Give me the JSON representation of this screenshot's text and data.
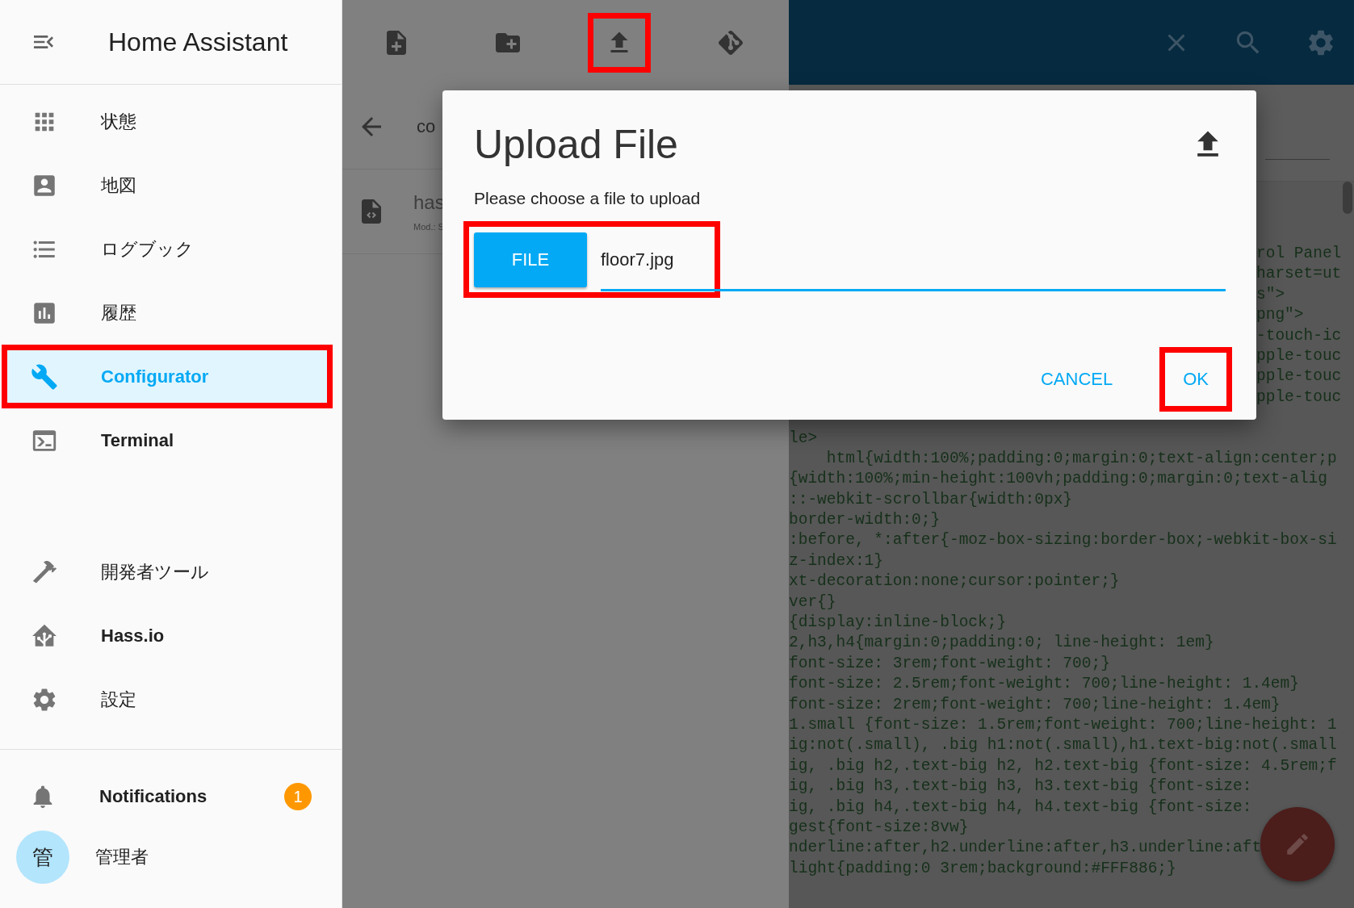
{
  "sidebar": {
    "title": "Home Assistant",
    "items": [
      {
        "label": "状態",
        "bold": false,
        "selected": false,
        "highlighted": false
      },
      {
        "label": "地図",
        "bold": false,
        "selected": false,
        "highlighted": false
      },
      {
        "label": "ログブック",
        "bold": false,
        "selected": false,
        "highlighted": false
      },
      {
        "label": "履歴",
        "bold": false,
        "selected": false,
        "highlighted": false
      },
      {
        "label": "Configurator",
        "bold": false,
        "selected": true,
        "highlighted": true
      },
      {
        "label": "Terminal",
        "bold": true,
        "selected": false,
        "highlighted": false
      }
    ],
    "tools": [
      {
        "label": "開発者ツール",
        "bold": false
      },
      {
        "label": "Hass.io",
        "bold": true
      },
      {
        "label": "設定",
        "bold": false
      }
    ],
    "notifications": {
      "label": "Notifications",
      "count": "1"
    },
    "user": {
      "initial": "管",
      "name": "管理者"
    }
  },
  "file_panel": {
    "toolbar": [
      {
        "highlighted": false
      },
      {
        "highlighted": false
      },
      {
        "highlighted": true
      },
      {
        "highlighted": false
      }
    ],
    "path": "co",
    "files": [
      {
        "name": "has",
        "meta": "Mod.: S"
      }
    ]
  },
  "editor": {
    "tail_lines": [
      "rol Panel",
      "harset=ut",
      "s\">",
      "png\">",
      "-touch-ic",
      "pple-touc",
      "pple-touc",
      "pple-touc"
    ],
    "lines": [
      "le>",
      "    html{width:100%;padding:0;margin:0;text-align:center;p",
      "{width:100%;min-height:100vh;padding:0;margin:0;text-alig",
      "::-webkit-scrollbar{width:0px}",
      "border-width:0;}",
      ":before, *:after{-moz-box-sizing:border-box;-webkit-box-si",
      "z-index:1}",
      "xt-decoration:none;cursor:pointer;}",
      "ver{}",
      "{display:inline-block;}",
      "2,h3,h4{margin:0;padding:0; line-height: 1em}",
      "font-size: 3rem;font-weight: 700;}",
      "font-size: 2.5rem;font-weight: 700;line-height: 1.4em}",
      "font-size: 2rem;font-weight: 700;line-height: 1.4em}",
      "1.small {font-size: 1.5rem;font-weight: 700;line-height: 1",
      "ig:not(.small), .big h1:not(.small),h1.text-big:not(.small",
      "ig, .big h2,.text-big h2, h2.text-big {font-size: 4.5rem;f",
      "ig, .big h3,.text-big h3, h3.text-big {font-size:",
      "ig, .big h4,.text-big h4, h4.text-big {font-size:",
      "gest{font-size:8vw}",
      "nderline:after,h2.underline:after,h3.underline:aft",
      "light{padding:0 3rem;background:#FFF886;}"
    ]
  },
  "dialog": {
    "title": "Upload File",
    "prompt": "Please choose a file to upload",
    "file_button": "FILE",
    "file_name": "floor7.jpg",
    "file_highlighted": true,
    "buttons": [
      {
        "label": "CANCEL",
        "highlighted": false
      },
      {
        "label": "OK",
        "highlighted": true
      }
    ]
  }
}
